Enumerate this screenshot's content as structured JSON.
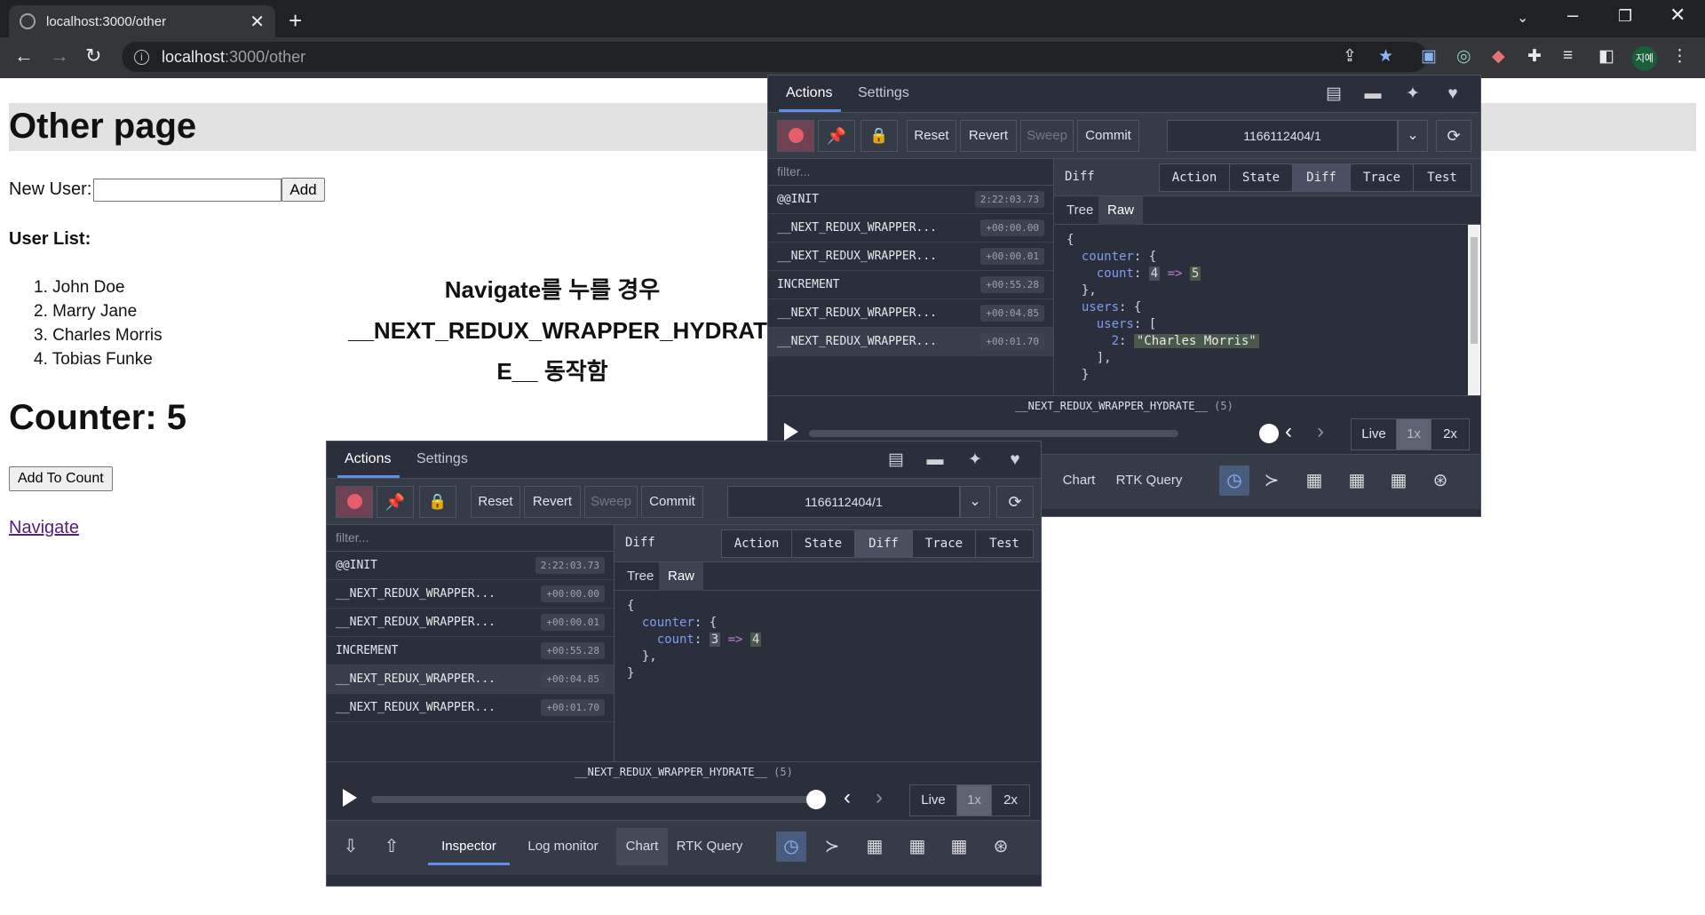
{
  "browser": {
    "tab_title": "localhost:3000/other",
    "url_host": "localhost",
    "url_path": ":3000/other",
    "profile_label": "지예"
  },
  "page": {
    "heading": "Other page",
    "new_user_label": "New User:",
    "add_button": "Add",
    "user_list_label": "User List:",
    "users": [
      "1. John Doe",
      "2. Marry Jane",
      "3. Charles Morris",
      "4. Tobias Funke"
    ],
    "note_line1": "Navigate를 누를 경우",
    "note_line2": "__NEXT_REDUX_WRAPPER_HYDRAT",
    "note_line3": "E__ 동작함",
    "counter": "Counter: 5",
    "add_to_count": "Add To Count",
    "navigate_link": "Navigate"
  },
  "devtools_common": {
    "tab_actions": "Actions",
    "tab_settings": "Settings",
    "btn_reset": "Reset",
    "btn_revert": "Revert",
    "btn_sweep": "Sweep",
    "btn_commit": "Commit",
    "instance": "1166112404/1",
    "filter_placeholder": "filter...",
    "diff_label": "Diff",
    "seg_action": "Action",
    "seg_state": "State",
    "seg_diff": "Diff",
    "seg_trace": "Trace",
    "seg_test": "Test",
    "sub_tree": "Tree",
    "sub_raw": "Raw",
    "slider_action": "__NEXT_REDUX_WRAPPER_HYDRATE__",
    "slider_count": "(5)",
    "speed_live": "Live",
    "speed_1x": "1x",
    "speed_2x": "2x",
    "bottom_inspector": "Inspector",
    "bottom_log": "Log monitor",
    "bottom_chart": "Chart",
    "bottom_rtk": "RTK Query"
  },
  "actions": [
    {
      "name": "@@INIT",
      "time": "2:22:03.73"
    },
    {
      "name": "__NEXT_REDUX_WRAPPER...",
      "time": "+00:00.00"
    },
    {
      "name": "__NEXT_REDUX_WRAPPER...",
      "time": "+00:00.01"
    },
    {
      "name": "INCREMENT",
      "time": "+00:55.28"
    },
    {
      "name": "__NEXT_REDUX_WRAPPER...",
      "time": "+00:04.85"
    },
    {
      "name": "__NEXT_REDUX_WRAPPER...",
      "time": "+00:01.70"
    }
  ],
  "diff_back": {
    "counter_key": "counter",
    "count_key": "count",
    "old": "4",
    "new": "5",
    "users_key": "users",
    "users_inner_key": "users",
    "index": "2",
    "added_user": "\"Charles Morris\""
  },
  "diff_front": {
    "counter_key": "counter",
    "count_key": "count",
    "old": "3",
    "new": "4"
  },
  "icons": {
    "record": "record-icon",
    "pin": "pin-icon",
    "lock": "lock-icon"
  }
}
